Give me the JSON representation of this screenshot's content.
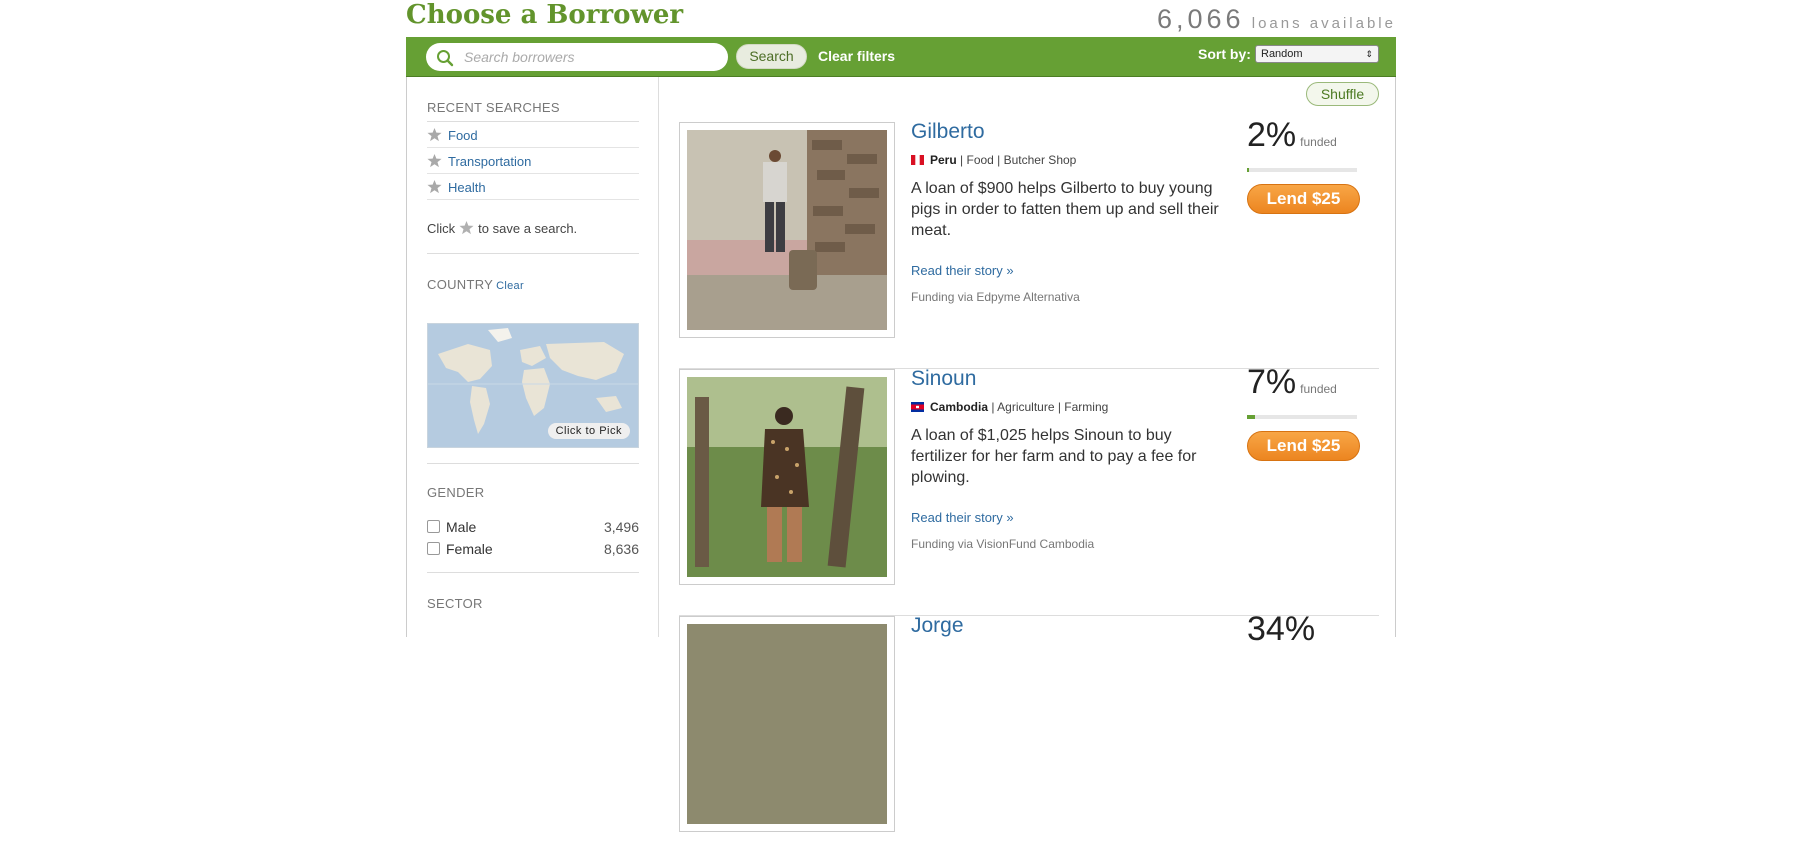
{
  "page": {
    "title": "Choose a Borrower",
    "loans_count": "6,066",
    "loans_label": "loans available"
  },
  "toolbar": {
    "search_placeholder": "Search borrowers",
    "search_label": "Search",
    "clear_filters": "Clear filters",
    "sort_label": "Sort by:",
    "sort_value": "Random"
  },
  "sidebar": {
    "recent_heading": "RECENT SEARCHES",
    "recent": [
      {
        "label": "Food"
      },
      {
        "label": "Transportation"
      },
      {
        "label": "Health"
      }
    ],
    "save_hint_pre": "Click",
    "save_hint_post": "to save a search.",
    "country_heading": "COUNTRY",
    "country_clear": "Clear",
    "map_label": "Click to Pick",
    "gender_heading": "GENDER",
    "gender": [
      {
        "label": "Male",
        "count": "3,496"
      },
      {
        "label": "Female",
        "count": "8,636"
      }
    ],
    "sector_heading": "SECTOR"
  },
  "main": {
    "shuffle_label": "Shuffle",
    "loans": [
      {
        "name": "Gilberto",
        "country": "Peru",
        "category": "| Food | Butcher Shop",
        "description": "A loan of $900 helps Gilberto to buy young pigs in order to fatten them up and sell their meat.",
        "story": "Read their story »",
        "via": "Funding via Edpyme Alternativa",
        "percent": "2%",
        "funded_label": "funded",
        "funded_fraction": 0.02,
        "lend_label": "Lend $25"
      },
      {
        "name": "Sinoun",
        "country": "Cambodia",
        "category": "| Agriculture | Farming",
        "description": "A loan of $1,025 helps Sinoun to buy fertilizer for her farm and to pay a fee for plowing.",
        "story": "Read their story »",
        "via": "Funding via VisionFund Cambodia",
        "percent": "7%",
        "funded_label": "funded",
        "funded_fraction": 0.07,
        "lend_label": "Lend $25"
      },
      {
        "name": "Jorge",
        "percent": "34%"
      }
    ]
  },
  "colors": {
    "brand_green": "#66a034",
    "title_green": "#62942c",
    "link_blue": "#2f6ba0",
    "lend_orange": "#ec8520"
  }
}
